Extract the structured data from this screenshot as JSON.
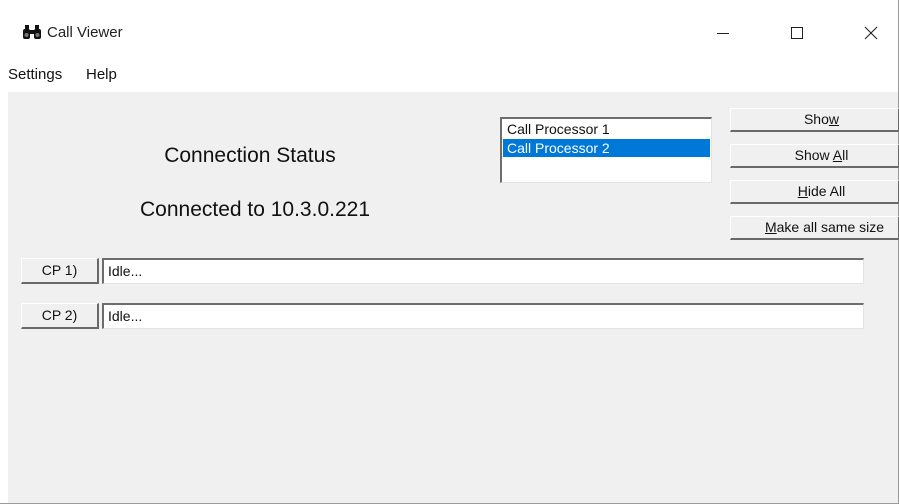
{
  "window": {
    "title": "Call Viewer",
    "app_icon": "binoculars-icon",
    "controls": {
      "minimize_icon": "minimize-icon",
      "maximize_icon": "maximize-icon",
      "close_icon": "close-icon"
    }
  },
  "menu": {
    "items": [
      {
        "label": "Settings"
      },
      {
        "label": "Help"
      }
    ]
  },
  "status": {
    "title": "Connection Status",
    "connection": "Connected to 10.3.0.221"
  },
  "processor_list": {
    "options": [
      {
        "label": "Call Processor 1",
        "selected": false
      },
      {
        "label": "Call Processor 2",
        "selected": true
      }
    ]
  },
  "buttons": {
    "show": {
      "label": "Show",
      "accel": "w"
    },
    "show_all": {
      "label": "Show All",
      "accel": "A"
    },
    "hide_all": {
      "label": "Hide All",
      "accel": "H"
    },
    "make_same_size": {
      "label": "Make all same size",
      "accel": "M"
    }
  },
  "call_processors": [
    {
      "button_label": "CP 1)",
      "status": "Idle..."
    },
    {
      "button_label": "CP 2)",
      "status": "Idle..."
    }
  ],
  "colors": {
    "client_bg": "#f0f0f0",
    "selection": "#0078d7"
  }
}
